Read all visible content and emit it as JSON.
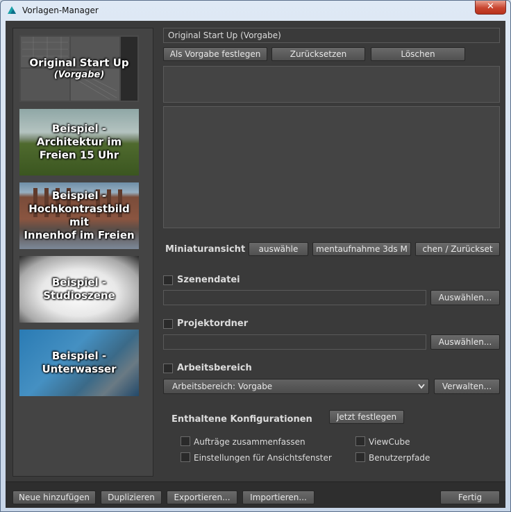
{
  "window": {
    "title": "Vorlagen-Manager",
    "close_glyph": "✕"
  },
  "templates": [
    {
      "line1": "Original Start Up",
      "line2": "(Vorgabe)",
      "line3": ""
    },
    {
      "line1": "Beispiel -",
      "line2": "Architektur im",
      "line3": "Freien 15 Uhr"
    },
    {
      "line1": "Beispiel -",
      "line2": "Hochkontrastbild mit",
      "line3": "Innenhof im Freien"
    },
    {
      "line1": "Beispiel -",
      "line2": "Studioszene",
      "line3": ""
    },
    {
      "line1": "Beispiel -",
      "line2": "Unterwasser",
      "line3": ""
    }
  ],
  "details": {
    "name_value": "Original Start Up (Vorgabe)",
    "set_default_label": "Als Vorgabe festlegen",
    "reset_label": "Zurücksetzen",
    "delete_label": "Löschen"
  },
  "thumbnail": {
    "label": "Miniaturansicht",
    "btn1": "auswähle",
    "btn2": "mentaufnahme 3ds M",
    "btn3": "chen / Zurückset"
  },
  "scene_file": {
    "label": "Szenendatei",
    "value": "",
    "browse_label": "Auswählen..."
  },
  "project_folder": {
    "label": "Projektordner",
    "value": "",
    "browse_label": "Auswählen..."
  },
  "workspace": {
    "label": "Arbeitsbereich",
    "selected": "Arbeitsbereich: Vorgabe",
    "manage_label": "Verwalten..."
  },
  "configs": {
    "heading": "Enthaltene Konfigurationen",
    "set_now_label": "Jetzt festlegen",
    "items": [
      {
        "label": "Aufträge zusammenfassen"
      },
      {
        "label": "Einstellungen für Ansichtsfenster"
      },
      {
        "label": "ViewCube"
      },
      {
        "label": "Benutzerpfade"
      }
    ]
  },
  "bottom": {
    "add_new": "Neue hinzufügen",
    "duplicate": "Duplizieren",
    "export": "Exportieren...",
    "import": "Importieren...",
    "done": "Fertig"
  },
  "colors": {
    "panel": "#3a3a3a",
    "button": "#5a5a5a",
    "close": "#c8452f"
  }
}
